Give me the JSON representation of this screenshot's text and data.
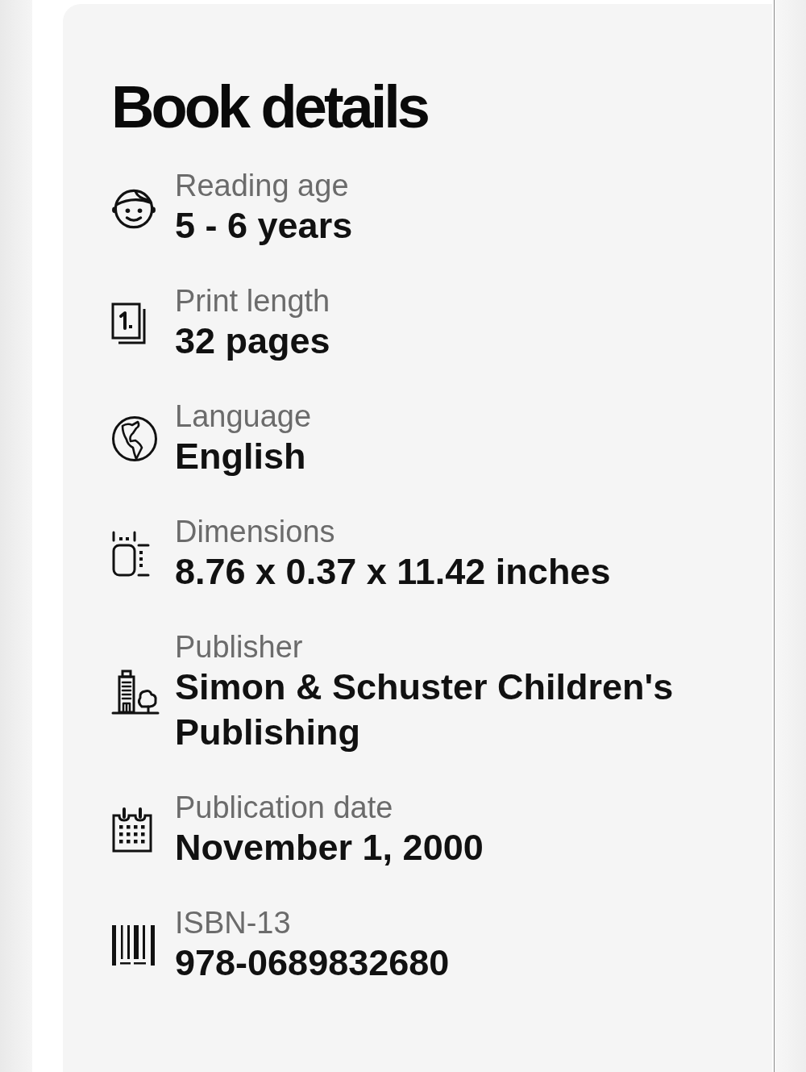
{
  "title": "Book details",
  "details": [
    {
      "kind": "reading_age",
      "label": "Reading age",
      "value": "5 - 6 years"
    },
    {
      "kind": "print_length",
      "label": "Print length",
      "value": "32 pages"
    },
    {
      "kind": "language",
      "label": "Language",
      "value": "English"
    },
    {
      "kind": "dimensions",
      "label": "Dimensions",
      "value": "8.76 x 0.37 x 11.42 inches"
    },
    {
      "kind": "publisher",
      "label": "Publisher",
      "value": "Simon & Schuster Children's Publishing"
    },
    {
      "kind": "publication_date",
      "label": "Publication date",
      "value": "November 1, 2000"
    },
    {
      "kind": "isbn",
      "label": "ISBN-13",
      "value": "978-0689832680"
    }
  ]
}
